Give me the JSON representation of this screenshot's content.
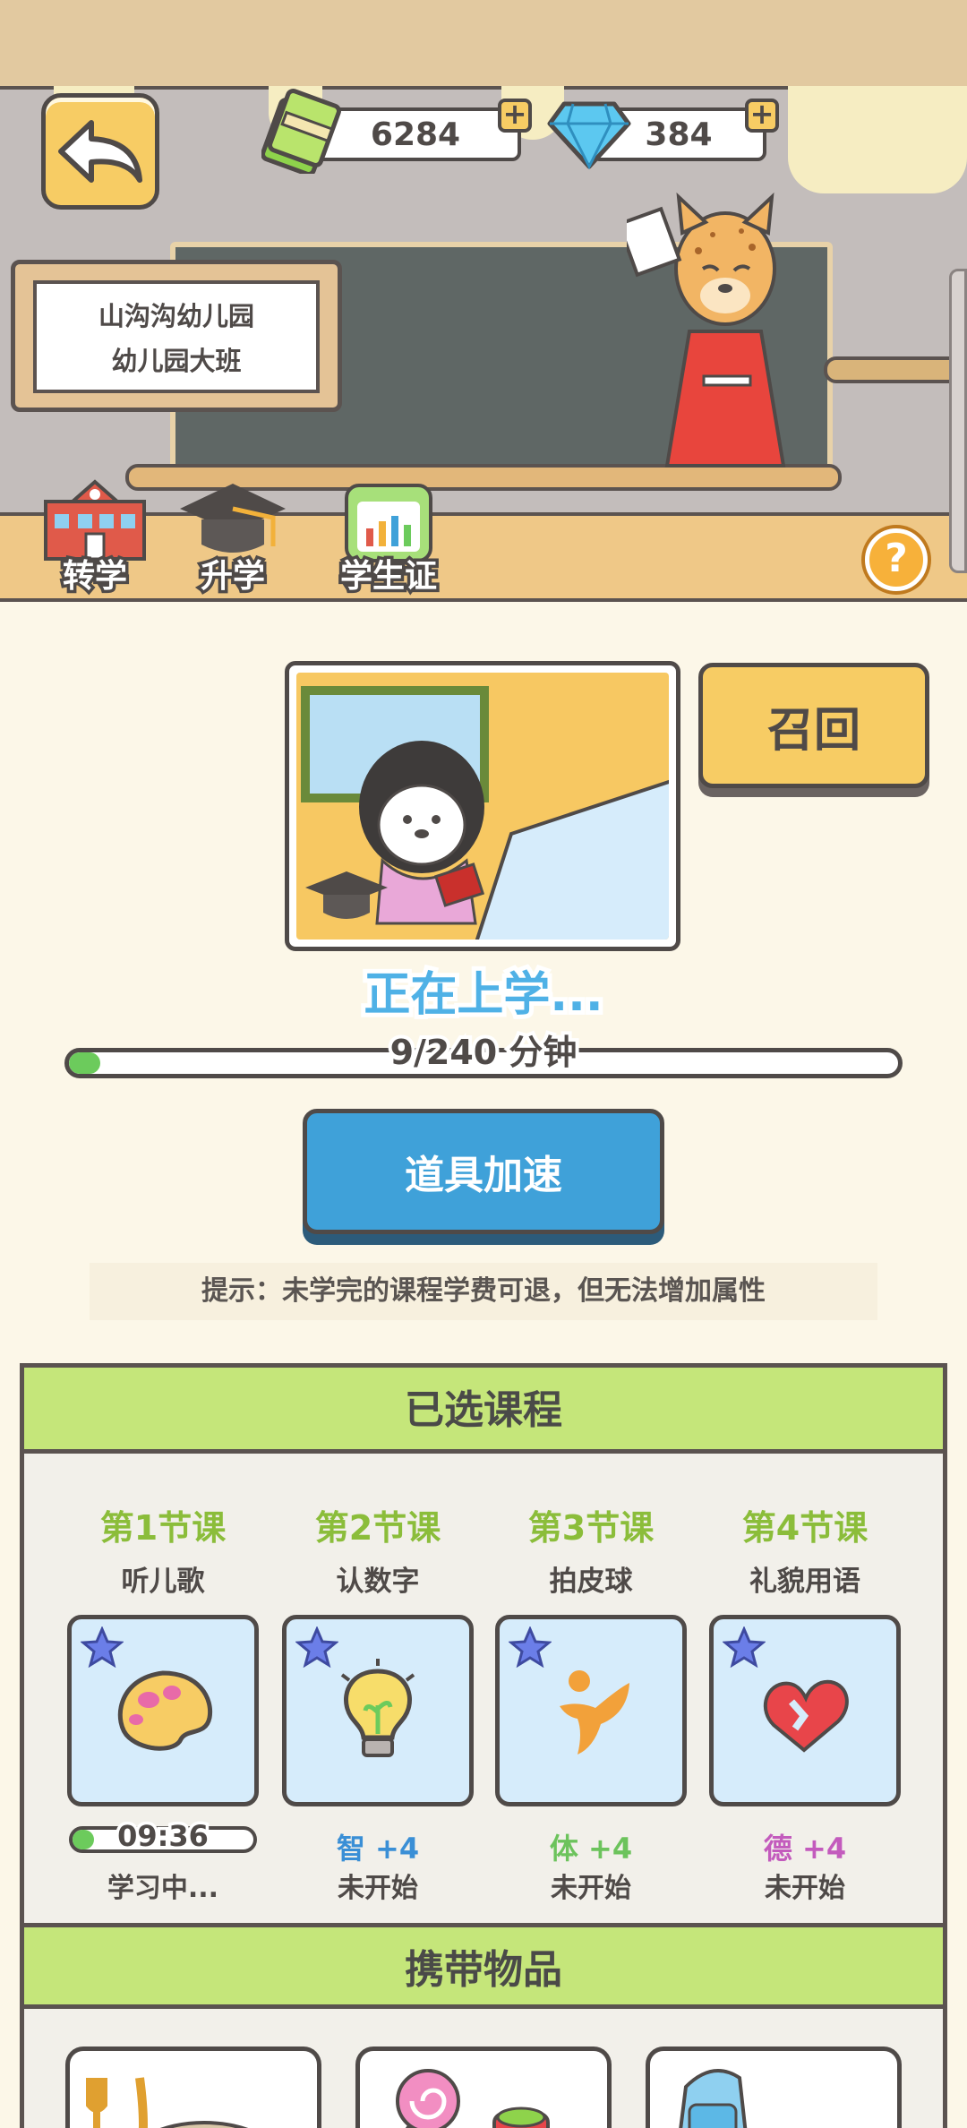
{
  "currency": {
    "cash": "6284",
    "diamonds": "384",
    "plus": "+"
  },
  "school_sign": {
    "school": "山沟沟幼儿园",
    "class": "幼儿园大班"
  },
  "toolbar": {
    "transfer": "转学",
    "promote": "升学",
    "student_card": "学生证",
    "help": "?"
  },
  "recall_label": "召回",
  "status": {
    "title": "正在上学...",
    "progress_text": "9/240 分钟",
    "progress_fraction": 0.0375
  },
  "speed_up_label": "道具加速",
  "hint": "提示：未学完的课程学费可退，但无法增加属性",
  "courses_panel": {
    "title": "已选课程",
    "courses": [
      {
        "number": "第1节课",
        "name": "听儿歌",
        "icon": "paint-palette-icon",
        "timer": "09:36",
        "timer_fraction": 0.12,
        "status": "学习中..."
      },
      {
        "number": "第2节课",
        "name": "认数字",
        "icon": "lightbulb-icon",
        "attr_name": "智",
        "attr_value": "+4",
        "attr_color": "#3a8fd6",
        "status": "未开始"
      },
      {
        "number": "第3节课",
        "name": "拍皮球",
        "icon": "running-figure-icon",
        "attr_name": "体",
        "attr_value": "+4",
        "attr_color": "#6cc35c",
        "status": "未开始"
      },
      {
        "number": "第4节课",
        "name": "礼貌用语",
        "icon": "heart-icon",
        "attr_name": "德",
        "attr_value": "+4",
        "attr_color": "#c35bbd",
        "status": "未开始"
      }
    ]
  },
  "items_panel": {
    "title": "携带物品",
    "items": [
      "utensils-icon",
      "lollipop-icon",
      "backpack-icon"
    ]
  }
}
